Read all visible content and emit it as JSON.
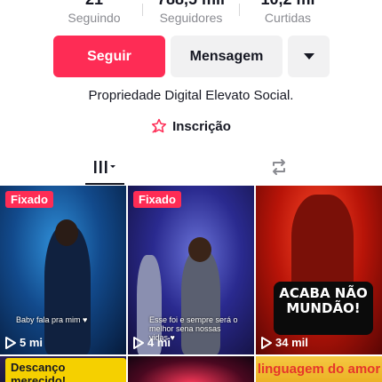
{
  "stats": [
    {
      "number": "21",
      "label": "Seguindo"
    },
    {
      "number": "788,5 mil",
      "label": "Seguidores"
    },
    {
      "number": "10,2 mi",
      "label": "Curtidas"
    }
  ],
  "actions": {
    "follow_label": "Seguir",
    "message_label": "Mensagem"
  },
  "bio": "Propriedade Digital Elevato Social.",
  "subscribe_label": "Inscrição",
  "tabs": [
    {
      "icon": "videos-grid-icon",
      "active": true
    },
    {
      "icon": "repost-icon",
      "active": false
    }
  ],
  "videos": [
    {
      "pinned_label": "Fixado",
      "views": "5 mi",
      "caption": "Baby fala pra mim ♥"
    },
    {
      "pinned_label": "Fixado",
      "views": "4 mi",
      "caption": "Esse foi e sempre será o melhor sena nossas vidas ♥"
    },
    {
      "views": "34 mil",
      "badge": "ACABA NÃO MUNDÃO!"
    },
    {
      "caption": "Descanço merecido!"
    },
    {},
    {
      "caption": "linguagem do amor"
    }
  ],
  "colors": {
    "accent": "#fe2c55",
    "secondary_button": "#f1f1f2",
    "text": "#161823",
    "muted": "#8a8b91"
  }
}
